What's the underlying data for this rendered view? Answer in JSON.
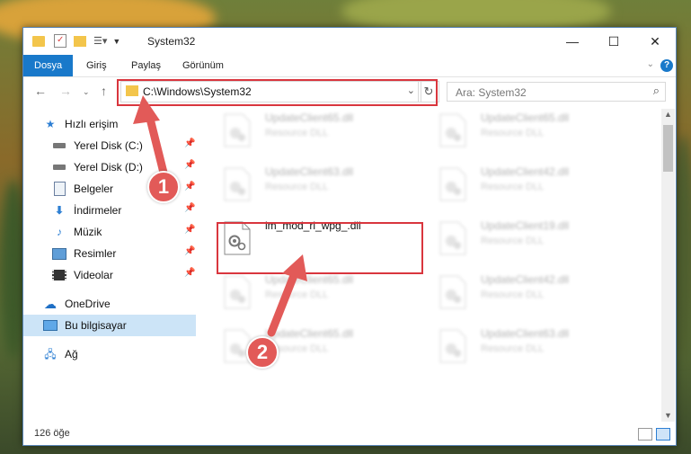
{
  "window": {
    "title": "System32",
    "minimize": "—",
    "maximize": "☐",
    "close": "✕"
  },
  "ribbon": {
    "tabs": [
      "Dosya",
      "Giriş",
      "Paylaş",
      "Görünüm"
    ],
    "help": "?"
  },
  "address": {
    "path": "C:\\Windows\\System32",
    "search_placeholder": "Ara: System32"
  },
  "sidebar": {
    "quick_access": "Hızlı erişim",
    "items": [
      {
        "label": "Yerel Disk (C:)",
        "icon": "drive-icon"
      },
      {
        "label": "Yerel Disk (D:)",
        "icon": "drive-icon"
      },
      {
        "label": "Belgeler",
        "icon": "documents-icon"
      },
      {
        "label": "İndirmeler",
        "icon": "downloads-icon"
      },
      {
        "label": "Müzik",
        "icon": "music-icon"
      },
      {
        "label": "Resimler",
        "icon": "pictures-icon"
      },
      {
        "label": "Videolar",
        "icon": "videos-icon"
      }
    ],
    "onedrive": "OneDrive",
    "this_pc": "Bu bilgisayar",
    "network": "Ağ"
  },
  "files": [
    {
      "name": "UpdateClient65.dll",
      "desc": "Resource DLL"
    },
    {
      "name": "UpdateClient65.dll",
      "desc": "Resource DLL"
    },
    {
      "name": "UpdateClient63.dll",
      "desc": "Resource DLL"
    },
    {
      "name": "UpdateClient42.dll",
      "desc": "Resource DLL"
    },
    {
      "name": "im_mod_rl_wpg_.dll",
      "desc": ""
    },
    {
      "name": "UpdateClient19.dll",
      "desc": "Resource DLL"
    },
    {
      "name": "UpdateClient65.dll",
      "desc": "Resource DLL"
    },
    {
      "name": "UpdateClient42.dll",
      "desc": "Resource DLL"
    },
    {
      "name": "UpdateClient65.dll",
      "desc": "Resource DLL"
    },
    {
      "name": "UpdateClient63.dll",
      "desc": "Resource DLL"
    }
  ],
  "status": {
    "count": "126 öğe"
  },
  "annotations": {
    "badge1": "1",
    "badge2": "2",
    "color": "#d9363e"
  }
}
